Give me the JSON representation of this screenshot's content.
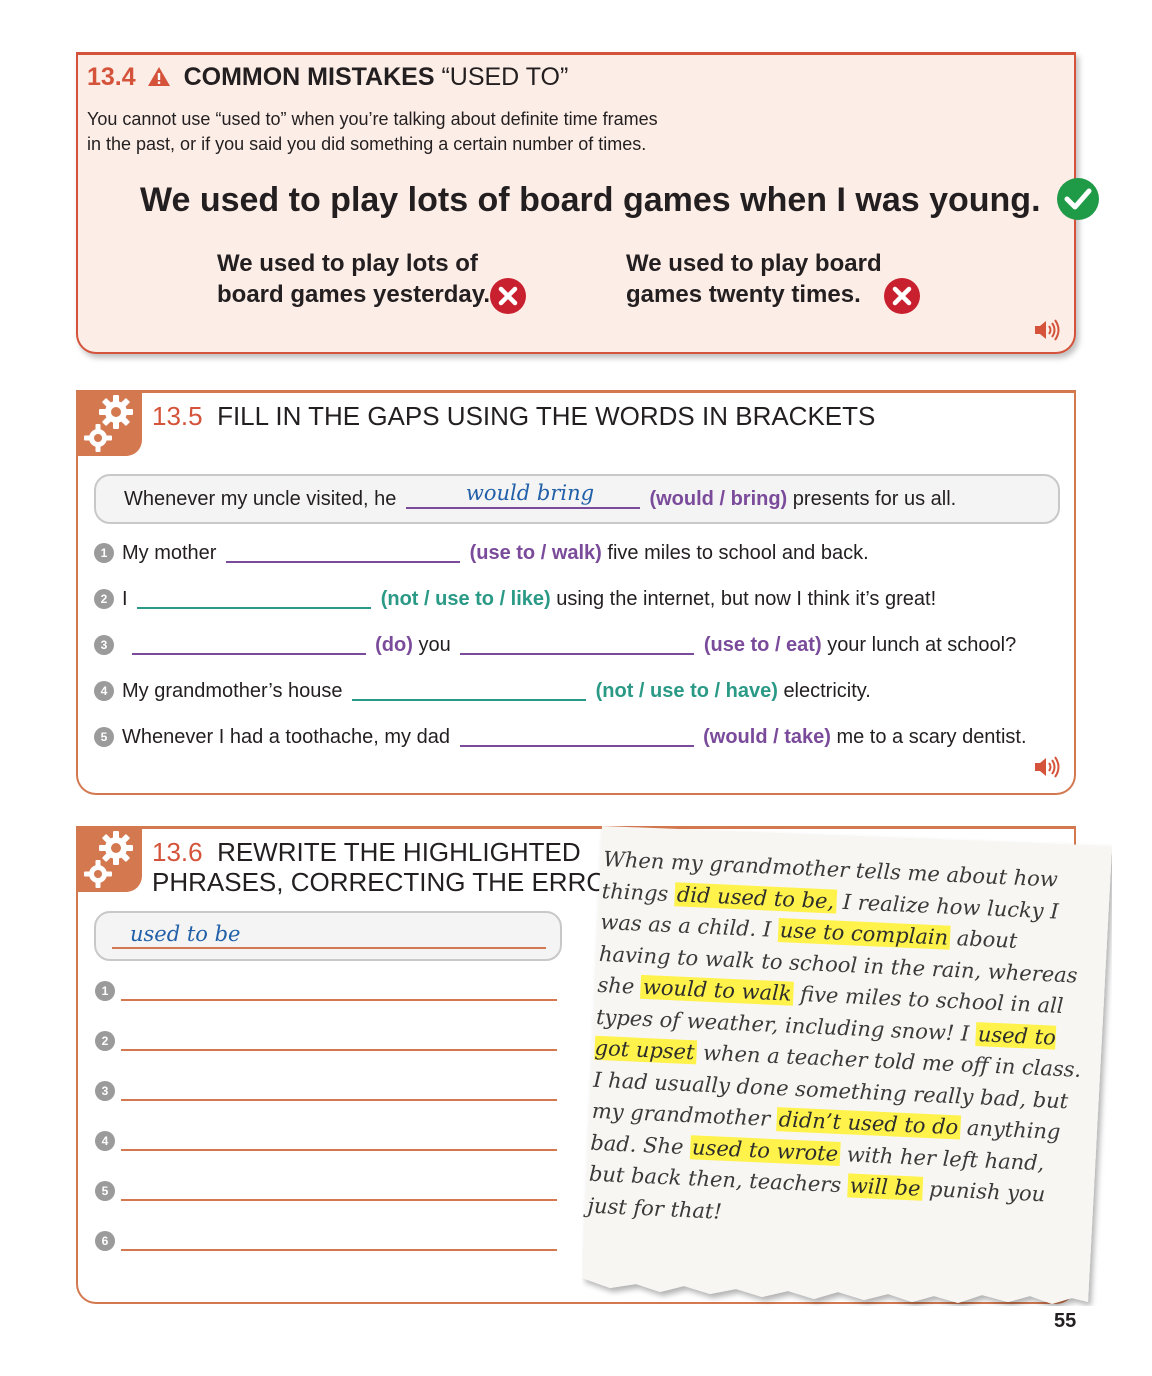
{
  "s134": {
    "number": "13.4",
    "title": "COMMON MISTAKES",
    "title_quote": "“USED TO”",
    "intro_line1": "You cannot use “used to” when you’re talking about definite time frames",
    "intro_line2": "in the past, or if you said you did something a certain number of times.",
    "correct_sentence": "We used to play lots of board games when I was young.",
    "wrong1_line1": "We used to play lots of",
    "wrong1_line2": "board games yesterday.",
    "wrong2_line1": "We used to play board",
    "wrong2_line2": "games twenty times."
  },
  "s135": {
    "number": "13.5",
    "title": "FILL IN THE GAPS USING THE WORDS IN BRACKETS",
    "example": {
      "before": "Whenever my uncle visited, he",
      "answer": "would bring",
      "prompt": "(would / bring)",
      "after": "presents for us all."
    },
    "items": [
      {
        "num": "1",
        "before": "My mother",
        "prompt": "(use to / walk)",
        "after": "five miles to school and back."
      },
      {
        "num": "2",
        "before": "I",
        "prompt": "(not / use to / like)",
        "after": "using the internet, but now I think it’s great!"
      },
      {
        "num": "3",
        "prompt_a": "(do)",
        "middle": "you",
        "prompt_b": "(use to / eat)",
        "after": "your lunch at school?"
      },
      {
        "num": "4",
        "before": "My grandmother’s house",
        "prompt": "(not / use to / have)",
        "after": "electricity."
      },
      {
        "num": "5",
        "before": "Whenever I had a toothache, my dad",
        "prompt": "(would / take)",
        "after": "me to a scary dentist."
      }
    ]
  },
  "s136": {
    "number": "13.6",
    "title_line1": "REWRITE THE HIGHLIGHTED",
    "title_line2": "PHRASES, CORRECTING THE ERRORS",
    "example_answer": "used to be",
    "line_numbers": [
      "1",
      "2",
      "3",
      "4",
      "5",
      "6"
    ],
    "note": [
      {
        "t": "When my grandmother tells me about how things "
      },
      {
        "h": "did used to be,"
      },
      {
        "t": " I realize how lucky I was as a child. I "
      },
      {
        "h": "use to complain"
      },
      {
        "t": " about having to walk to school in the rain, whereas she "
      },
      {
        "h": "would to walk"
      },
      {
        "t": " five miles to school in all types of weather, including snow! I "
      },
      {
        "h": "used to got upset"
      },
      {
        "t": " when a teacher told me off in class. I had usually done something really bad, but my grandmother "
      },
      {
        "h": "didn’t used to do"
      },
      {
        "t": " anything bad. She "
      },
      {
        "h": "used to wrote"
      },
      {
        "t": " with her left hand, but back then, teachers "
      },
      {
        "h": "will be"
      },
      {
        "t": " punish you just for that!"
      }
    ]
  },
  "page_number": "55",
  "icons": {
    "warning": "warning-triangle-icon",
    "correct": "check-circle-icon",
    "wrong": "x-circle-icon",
    "audio": "speaker-icon",
    "gear": "gear-icon"
  },
  "colors": {
    "accent": "#d4533a",
    "purple": "#7b4b9b",
    "green": "#2a9a86",
    "check": "#1f9a47",
    "cross": "#c8202e",
    "highlight": "#fff24a"
  }
}
